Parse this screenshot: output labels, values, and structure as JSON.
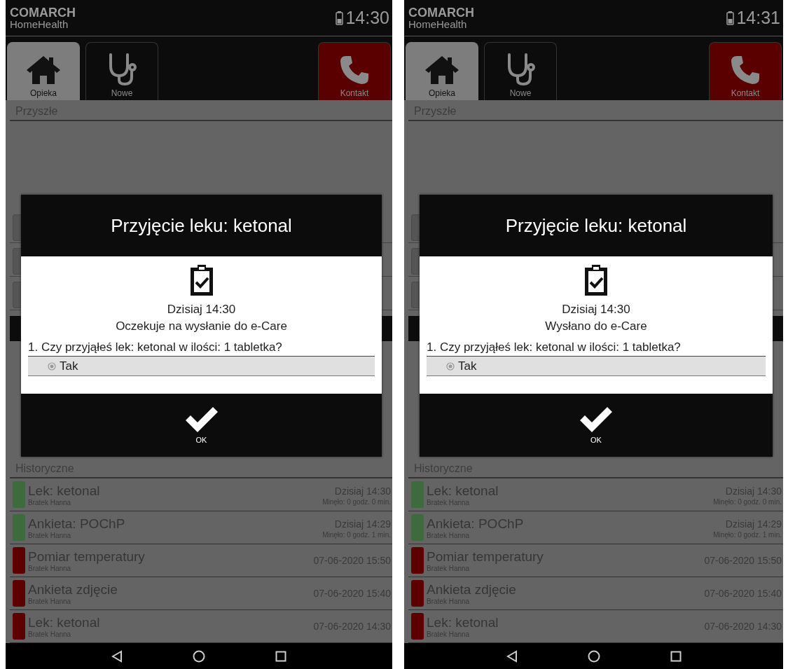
{
  "phones": [
    {
      "status": {
        "brand": "COMARCH",
        "product": "HomeHealth",
        "time": "14:30"
      },
      "tabs": [
        {
          "label": "Opieka",
          "kind": "home",
          "selected": true
        },
        {
          "label": "Nowe",
          "kind": "stethoscope",
          "selected": false
        },
        {
          "label": "Kontakt",
          "kind": "contact",
          "selected": false
        }
      ],
      "upcoming": {
        "title": "Przyszłe"
      },
      "history": {
        "title": "Historyczne",
        "rows": [
          {
            "title": "Lek: ketonal",
            "person": "Bratek Hanna",
            "date": "Dzisiaj 14:30",
            "elapsed": "Minęło: 0 godz. 0 min.",
            "color": "#3d6b3d"
          },
          {
            "title": "Ankieta: POChP",
            "person": "Bratek Hanna",
            "date": "Dzisiaj 14:29",
            "elapsed": "Minęło: 0 godz. 1 min.",
            "color": "#3d6b3d"
          },
          {
            "title": "Pomiar temperatury",
            "person": "Bratek Hanna",
            "date": "07-06-2020 15:50",
            "color": "#5c0000"
          },
          {
            "title": "Ankieta zdjęcie",
            "person": "Bratek Hanna",
            "date": "07-06-2020 15:40",
            "color": "#5c0000"
          },
          {
            "title": "Lek: ketonal",
            "person": "Bratek Hanna",
            "date": "07-06-2020 14:30",
            "color": "#5c0000"
          }
        ]
      },
      "dialog": {
        "title": "Przyjęcie leku: ketonal",
        "date": "Dzisiaj 14:30",
        "status": "Oczekuje na wysłanie do e-Care",
        "question": "1. Czy przyjąłeś lek: ketonal w ilości: 1 tabletka?",
        "answers": [
          {
            "label": "Tak",
            "selected": true
          }
        ],
        "ok": "OK"
      }
    },
    {
      "status": {
        "brand": "COMARCH",
        "product": "HomeHealth",
        "time": "14:31"
      },
      "tabs": [
        {
          "label": "Opieka",
          "kind": "home",
          "selected": true
        },
        {
          "label": "Nowe",
          "kind": "stethoscope",
          "selected": false
        },
        {
          "label": "Kontakt",
          "kind": "contact",
          "selected": false
        }
      ],
      "upcoming": {
        "title": "Przyszłe"
      },
      "history": {
        "title": "Historyczne",
        "rows": [
          {
            "title": "Lek: ketonal",
            "person": "Bratek Hanna",
            "date": "Dzisiaj 14:30",
            "elapsed": "Minęło: 0 godz. 0 min.",
            "color": "#3d6b3d"
          },
          {
            "title": "Ankieta: POChP",
            "person": "Bratek Hanna",
            "date": "Dzisiaj 14:29",
            "elapsed": "Minęło: 0 godz. 1 min.",
            "color": "#3d6b3d"
          },
          {
            "title": "Pomiar temperatury",
            "person": "Bratek Hanna",
            "date": "07-06-2020 15:50",
            "color": "#5c0000"
          },
          {
            "title": "Ankieta zdjęcie",
            "person": "Bratek Hanna",
            "date": "07-06-2020 15:40",
            "color": "#5c0000"
          },
          {
            "title": "Lek: ketonal",
            "person": "Bratek Hanna",
            "date": "07-06-2020 14:30",
            "color": "#5c0000"
          }
        ]
      },
      "dialog": {
        "title": "Przyjęcie leku: ketonal",
        "date": "Dzisiaj 14:30",
        "status": "Wysłano do e-Care",
        "question": "1. Czy przyjąłeś lek: ketonal w ilości: 1 tabletka?",
        "answers": [
          {
            "label": "Tak",
            "selected": true
          }
        ],
        "ok": "OK"
      }
    }
  ]
}
